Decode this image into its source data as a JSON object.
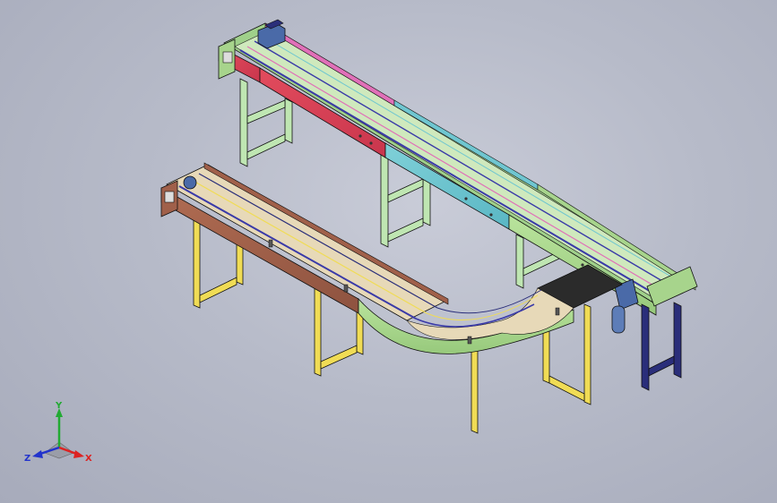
{
  "viewport": {
    "background_top": "#c9ccd8",
    "background_bottom": "#a7abbb"
  },
  "model": {
    "subject": "conveyor-assembly",
    "colors": {
      "frame_green": "#a7d48c",
      "frame_red": "#d8435a",
      "frame_pink": "#e070b8",
      "frame_cyan": "#6fc6d0",
      "frame_brown": "#a0604a",
      "rail_blue": "#3a3aa8",
      "leg_light_green": "#bfe6b2",
      "leg_yellow": "#f0dc55",
      "leg_navy": "#2a2e7a",
      "belt_dark": "#2b2b2b",
      "motor_blue": "#4a6aa8",
      "outline": "#111111"
    }
  },
  "triad": {
    "y_label": "Y",
    "x_label": "X",
    "z_label": "Z",
    "y_color": "#22aa33",
    "x_color": "#dd2222",
    "z_color": "#2233cc"
  }
}
